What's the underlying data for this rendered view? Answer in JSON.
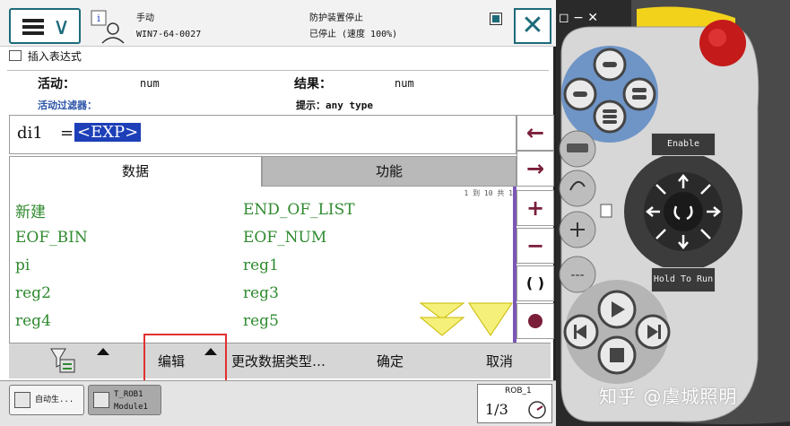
{
  "header": {
    "mode": "手动",
    "system": "WIN7-64-0027",
    "safety": "防护装置停止",
    "status": "已停止 (速度 100%)"
  },
  "page_title": "插入表达式",
  "info": {
    "active_label": "活动：",
    "active_value": "num",
    "result_label": "结果：",
    "result_value": "num",
    "filter_label": "活动过滤器：",
    "hint": "提示：any type"
  },
  "expression": {
    "variable": "di1",
    "equals": "=",
    "placeholder": "<EXP>"
  },
  "tabs": {
    "data": "数据",
    "functions": "功能"
  },
  "list": {
    "page_indicator": "1 到 10 共 1",
    "items": [
      "新建",
      "END_OF_LIST",
      "EOF_BIN",
      "EOF_NUM",
      "pi",
      "reg1",
      "reg2",
      "reg3",
      "reg4",
      "reg5"
    ]
  },
  "side_buttons": {
    "left": "←",
    "right": "→",
    "plus": "+",
    "minus": "−",
    "paren": "( )"
  },
  "bottom": {
    "edit": "编辑",
    "change_type": "更改数据类型…",
    "ok": "确定",
    "cancel": "取消"
  },
  "taskbar": {
    "auto_label": "自动生...",
    "rob_line1": "T_ROB1",
    "rob_line2": "Module1",
    "rob_id": "ROB_1",
    "speed": "1/3"
  },
  "pendant": {
    "enable_label": "Enable",
    "hold_label": "Hold To Run",
    "window_controls": "◻ − ✕"
  },
  "watermark": "知乎 @虞城照明",
  "colors": {
    "accent": "#1d6b7a",
    "item_text": "#2f8a2f",
    "exp_highlight": "#1d3fb8",
    "side_button_icon": "#7a1e3a",
    "highlight_box": "#e03030",
    "pendant_yellow": "#f2d21a",
    "pendant_blue": "#6f95c7"
  }
}
